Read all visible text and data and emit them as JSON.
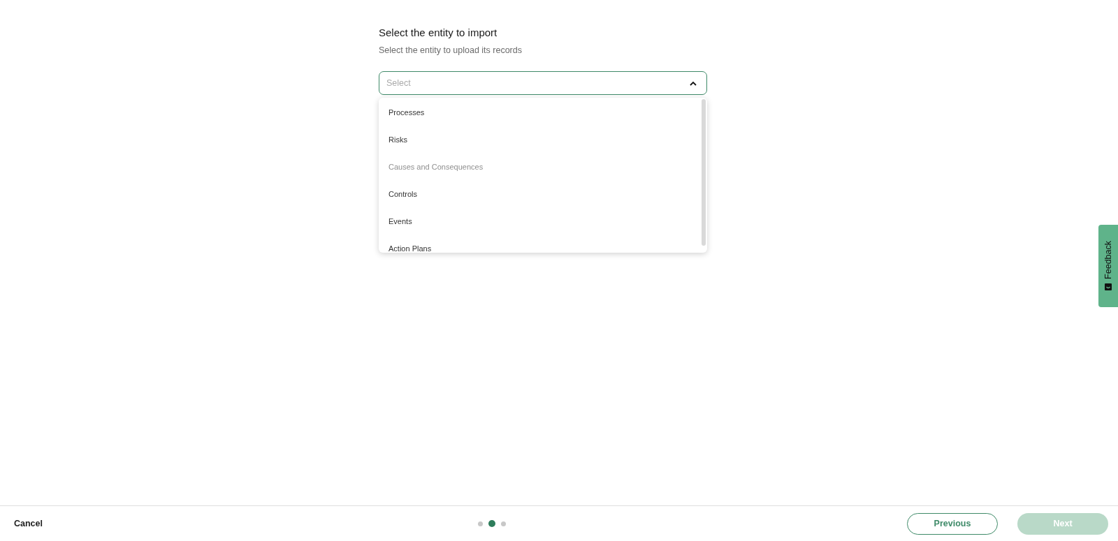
{
  "header": {
    "title": "Select the entity to import",
    "subtitle": "Select the entity to upload its records"
  },
  "select": {
    "placeholder": "Select",
    "expanded": true,
    "options": [
      {
        "label": "Processes",
        "disabled": false
      },
      {
        "label": "Risks",
        "disabled": false
      },
      {
        "label": "Causes and Consequences",
        "disabled": true
      },
      {
        "label": "Controls",
        "disabled": false
      },
      {
        "label": "Events",
        "disabled": false
      },
      {
        "label": "Action Plans",
        "disabled": false
      }
    ]
  },
  "feedback_tab": {
    "label": "Feedback"
  },
  "footer": {
    "cancel": "Cancel",
    "steps": [
      {
        "selected": false
      },
      {
        "selected": true
      },
      {
        "selected": false
      }
    ],
    "previous": {
      "label": "Previous",
      "disabled": false
    },
    "next": {
      "label": "Next",
      "disabled": true
    }
  }
}
